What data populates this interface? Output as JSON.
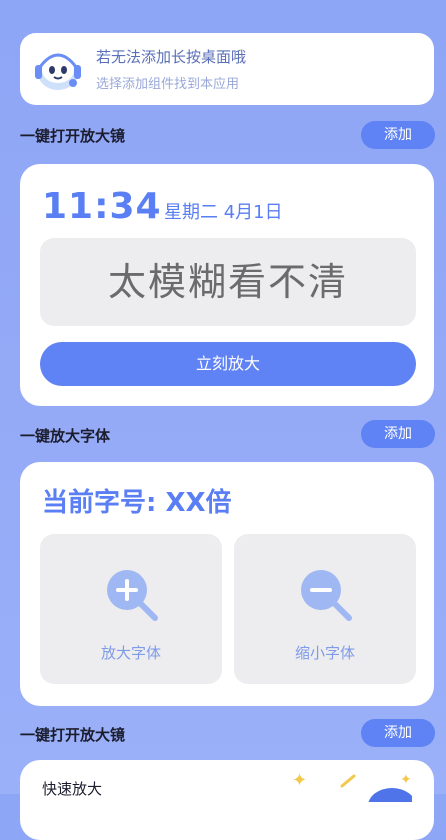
{
  "tip": {
    "title": "若无法添加长按桌面哦",
    "subtitle": "选择添加组件找到本应用"
  },
  "sections": [
    {
      "title": "一键打开放大镜",
      "add_label": "添加"
    },
    {
      "title": "一键放大字体",
      "add_label": "添加"
    },
    {
      "title": "一键打开放大镜",
      "add_label": "添加"
    }
  ],
  "magnifier_card": {
    "time": "11:34",
    "date": "星期二  4月1日",
    "blur_text": "太模糊看不清",
    "zoom_button": "立刻放大"
  },
  "font_card": {
    "current_size": "当前字号: XX倍",
    "enlarge_label": "放大字体",
    "shrink_label": "缩小字体"
  },
  "quick_card": {
    "title": "快速放大"
  },
  "colors": {
    "accent": "#5f82f4",
    "background_top": "#8ea6f6",
    "tile_bg": "#ededf0"
  },
  "icons": {
    "mascot": "robot-mascot-icon",
    "enlarge": "zoom-in-icon",
    "shrink": "zoom-out-icon",
    "sparkle": "sparkle-icon"
  }
}
